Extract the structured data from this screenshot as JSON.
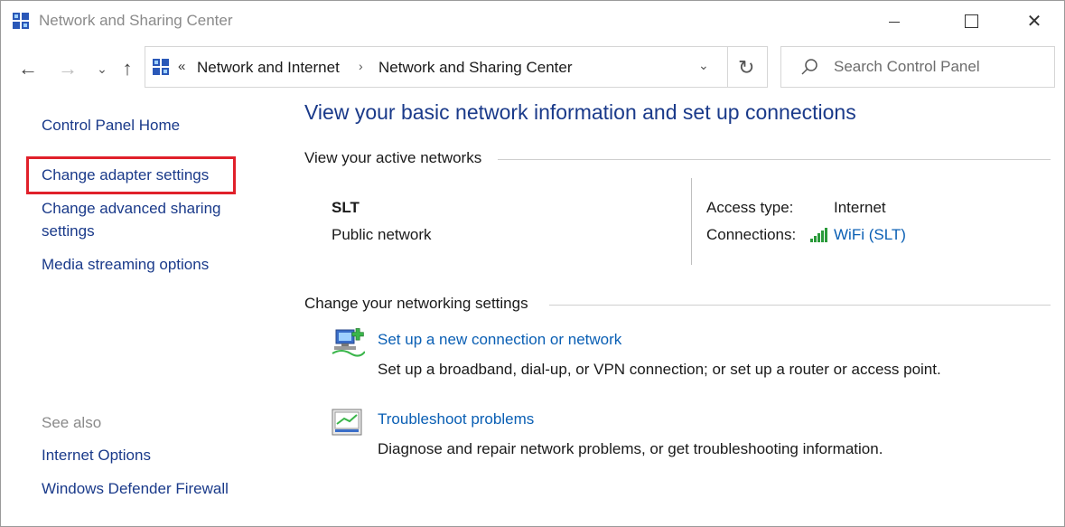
{
  "window": {
    "title": "Network and Sharing Center"
  },
  "nav": {
    "breadcrumb_overflow": "«",
    "crumbs": [
      "Network and Internet",
      "Network and Sharing Center"
    ],
    "search_placeholder": "Search Control Panel"
  },
  "left_pane": {
    "home_link": "Control Panel Home",
    "links": [
      "Change adapter settings",
      "Change advanced sharing",
      "settings",
      "Media streaming options"
    ],
    "see_also_label": "See also",
    "see_also_links": [
      "Internet Options",
      "Windows Defender Firewall"
    ]
  },
  "main": {
    "title": "View your basic network information and set up connections",
    "active_networks_heading": "View your active networks",
    "network": {
      "name": "SLT",
      "type": "Public network",
      "access_type_label": "Access type:",
      "access_type_value": "Internet",
      "connections_label": "Connections:",
      "connection_link": "WiFi (SLT)"
    },
    "change_settings_heading": "Change your networking settings",
    "tasks": [
      {
        "link": "Set up a new connection or network",
        "description": "Set up a broadband, dial-up, or VPN connection; or set up a router or access point."
      },
      {
        "link": "Troubleshoot problems",
        "description": "Diagnose and repair network problems, or get troubleshooting information."
      }
    ]
  },
  "colors": {
    "link_blue": "#0a5fb4",
    "title_blue": "#1a3a8a",
    "highlight_red": "#e0202a",
    "wifi_green": "#2a9a3a"
  }
}
